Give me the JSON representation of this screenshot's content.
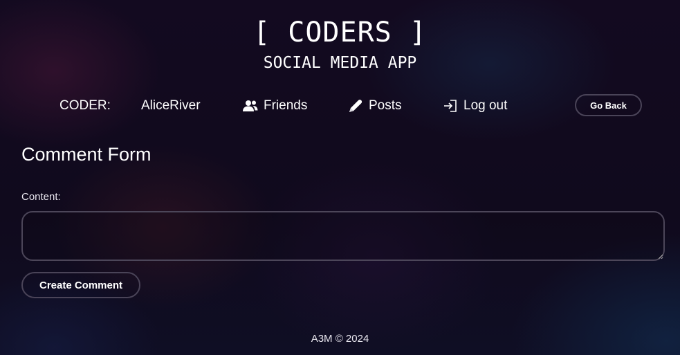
{
  "header": {
    "title": "[ CODERS ]",
    "subtitle": "SOCIAL MEDIA APP"
  },
  "nav": {
    "coder_label": "CODER:",
    "username": "AliceRiver",
    "friends": {
      "label": "Friends",
      "icon": "users-icon"
    },
    "posts": {
      "label": "Posts",
      "icon": "pencil-icon"
    },
    "logout": {
      "label": "Log out",
      "icon": "sign-in-icon"
    },
    "go_back": "Go Back"
  },
  "form": {
    "title": "Comment Form",
    "content_label": "Content:",
    "content_value": "",
    "content_placeholder": "",
    "submit_label": "Create Comment"
  },
  "footer": {
    "text": "A3M © 2024"
  },
  "colors": {
    "background": "#120a1f",
    "text": "#ffffff",
    "border": "#4a4458"
  }
}
